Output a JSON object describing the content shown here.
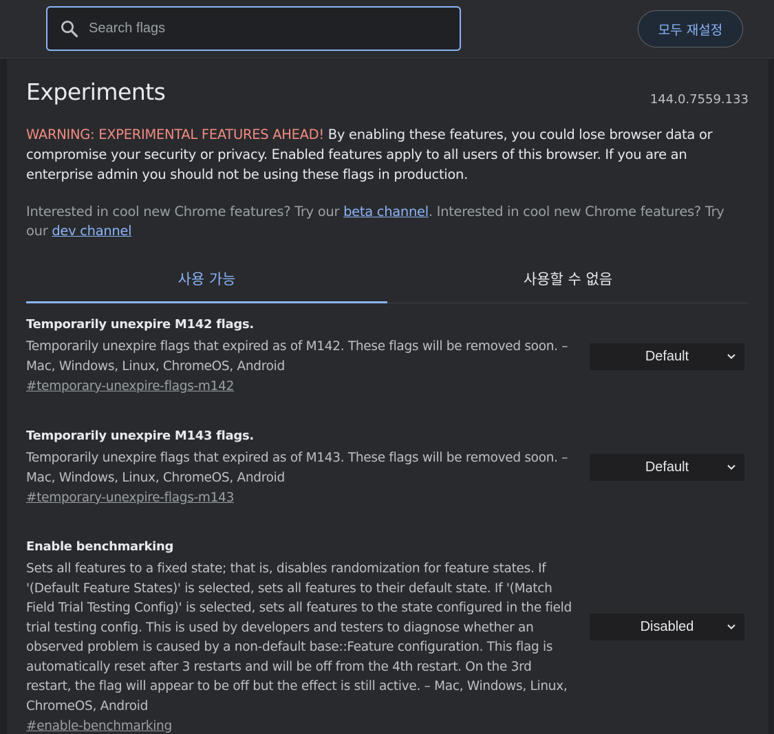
{
  "search": {
    "placeholder": "Search flags",
    "value": ""
  },
  "header": {
    "reset_label": "모두 재설정"
  },
  "page": {
    "title": "Experiments",
    "version": "144.0.7559.133",
    "warning_label": "WARNING: EXPERIMENTAL FEATURES AHEAD!",
    "warning_text": " By enabling these features, you could lose browser data or compromise your security or privacy. Enabled features apply to all users of this browser. If you are an enterprise admin you should not be using these flags in production.",
    "promo_text_1": "Interested in cool new Chrome features? Try our ",
    "promo_link_1": "beta channel",
    "promo_text_2": ". Interested in cool new Chrome features? Try our ",
    "promo_link_2": "dev channel"
  },
  "tabs": [
    {
      "label": "사용 가능",
      "active": true
    },
    {
      "label": "사용할 수 없음",
      "active": false
    }
  ],
  "flags": [
    {
      "title": "Temporarily unexpire M142 flags.",
      "description": "Temporarily unexpire flags that expired as of M142. These flags will be removed soon. – Mac, Windows, Linux, ChromeOS, Android",
      "link": "#temporary-unexpire-flags-m142",
      "selected": "Default"
    },
    {
      "title": "Temporarily unexpire M143 flags.",
      "description": "Temporarily unexpire flags that expired as of M143. These flags will be removed soon. – Mac, Windows, Linux, ChromeOS, Android",
      "link": "#temporary-unexpire-flags-m143",
      "selected": "Default"
    },
    {
      "title": "Enable benchmarking",
      "description": "Sets all features to a fixed state; that is, disables randomization for feature states. If '(Default Feature States)' is selected, sets all features to their default state. If '(Match Field Trial Testing Config)' is selected, sets all features to the state configured in the field trial testing config. This is used by developers and testers to diagnose whether an observed problem is caused by a non-default base::Feature configuration. This flag is automatically reset after 3 restarts and will be off from the 4th restart. On the 3rd restart, the flag will appear to be off but the effect is still active. – Mac, Windows, Linux, ChromeOS, Android",
      "link": "#enable-benchmarking",
      "selected": "Disabled"
    }
  ],
  "colors": {
    "accent": "#8ab4f8",
    "warning": "#f28b82",
    "background": "#202124",
    "panel": "#292a2d"
  },
  "icons": {
    "search": "search-icon",
    "dropdown": "chevron-down-icon"
  }
}
